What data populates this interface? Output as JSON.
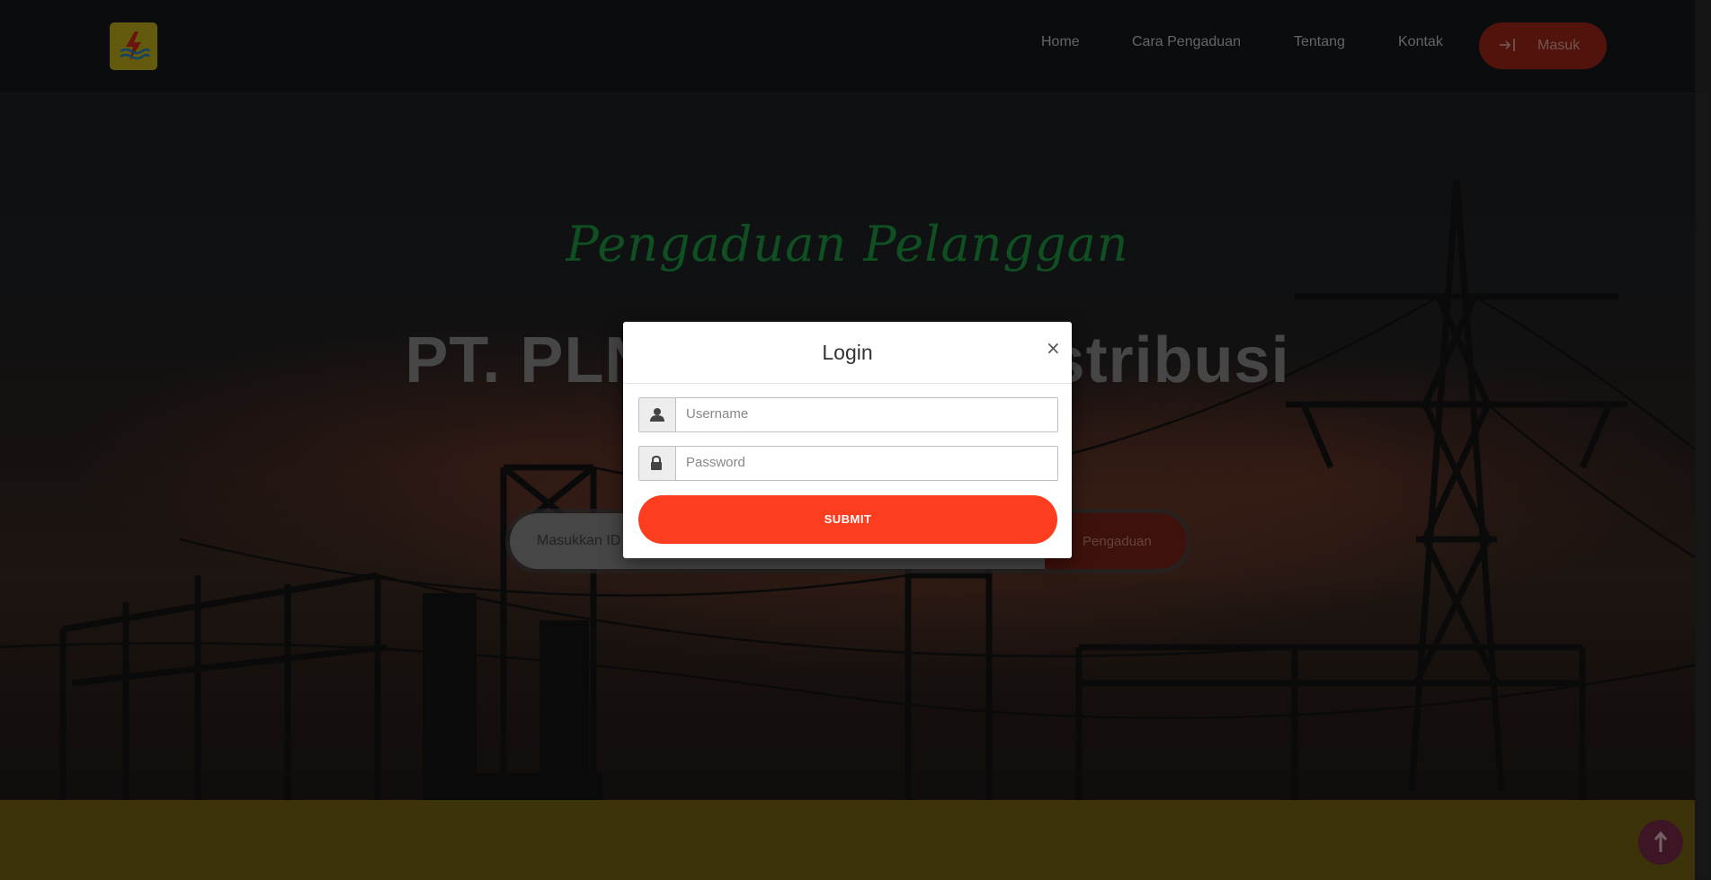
{
  "nav": {
    "items": [
      "Home",
      "Cara Pengaduan",
      "Tentang",
      "Kontak"
    ],
    "login_label": "Masuk"
  },
  "hero": {
    "script_title": "Pengaduan Pelanggan",
    "company_name": "PT. PLN (Persero) Distribusi",
    "search_placeholder": "Masukkan ID Pelanggan",
    "search_button": "Pengaduan"
  },
  "modal": {
    "title": "Login",
    "close": "×",
    "username_placeholder": "Username",
    "password_placeholder": "Password",
    "submit_label": "SUBMIT"
  },
  "colors": {
    "accent_red": "#fc3d20",
    "script_green": "#1f9e44",
    "logo_yellow": "#c9b51a",
    "footer_yellow": "#7a6616"
  }
}
